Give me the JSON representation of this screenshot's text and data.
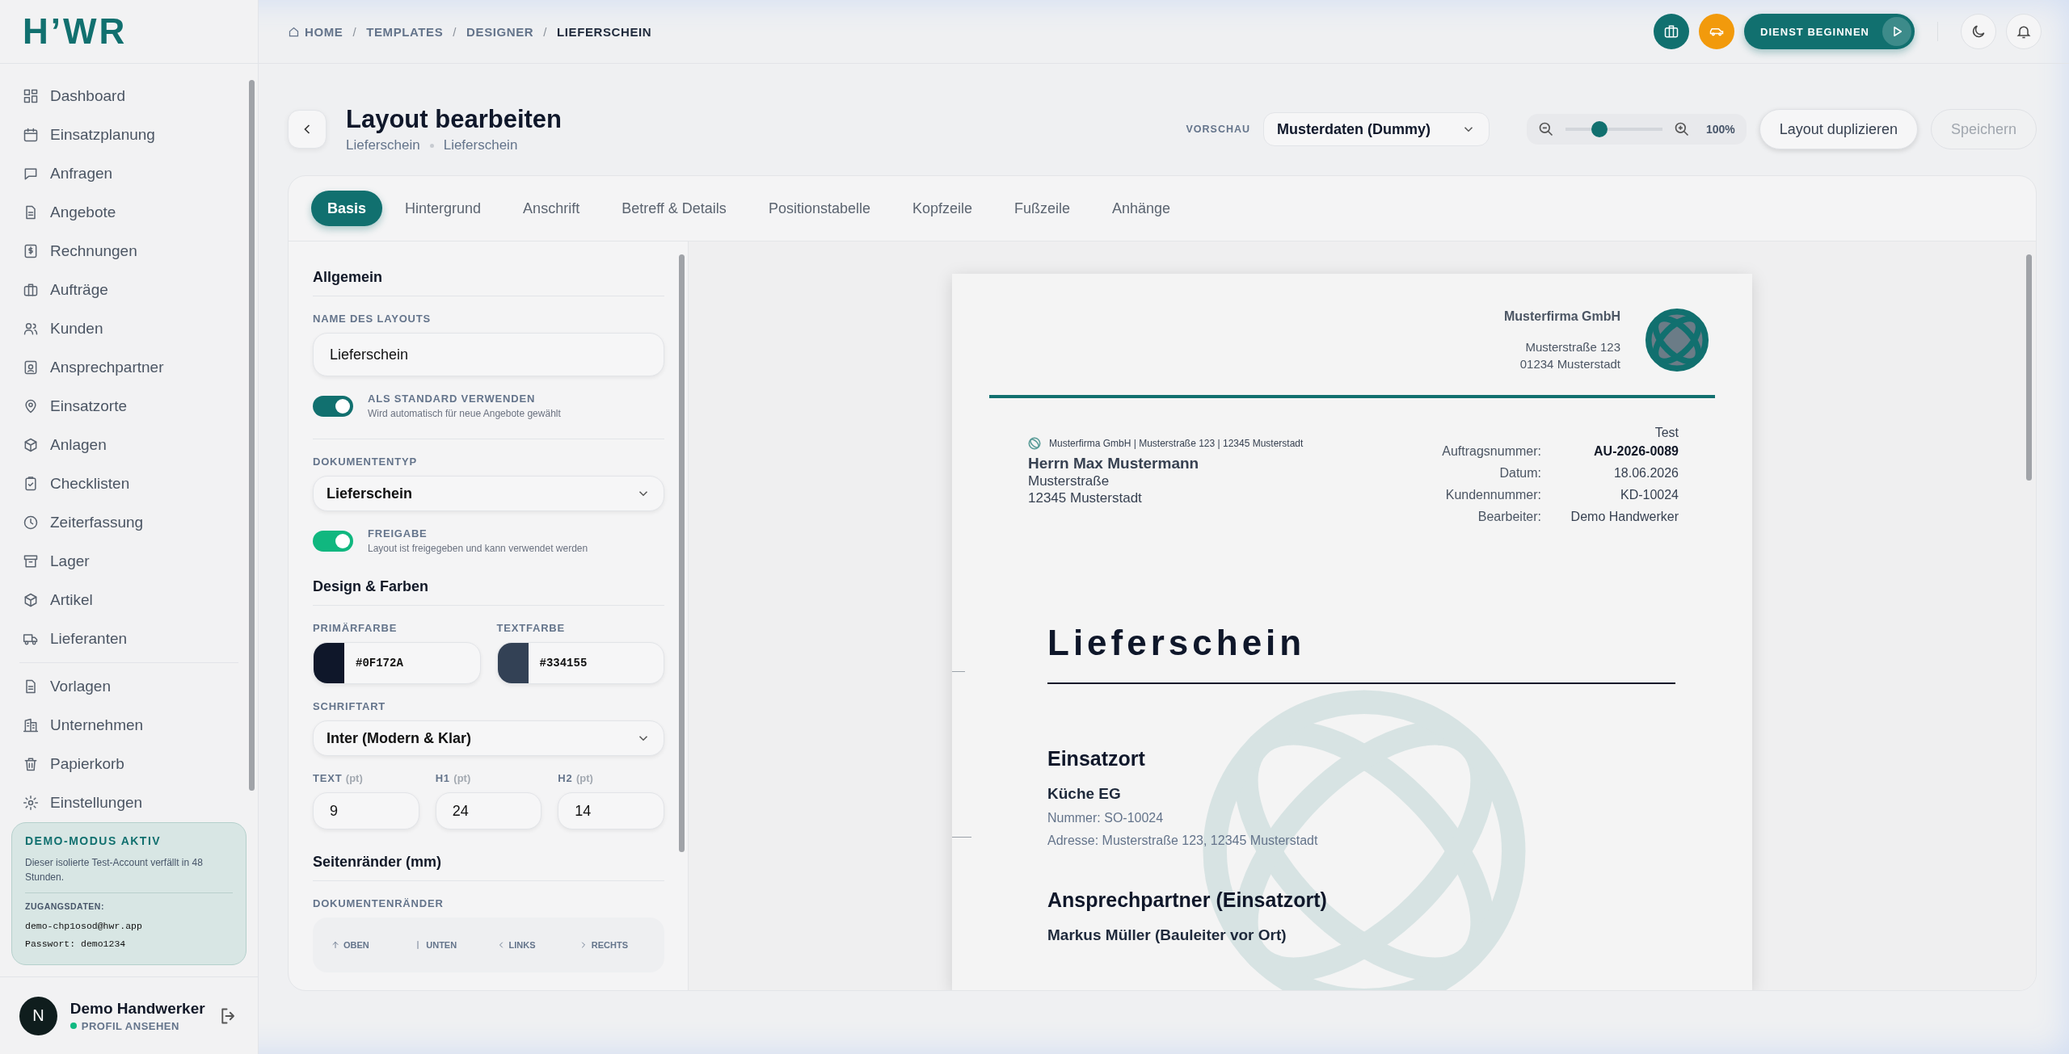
{
  "sidebar": {
    "logo": "H’WR",
    "nav_groups": [
      [
        "Dashboard",
        "Einsatzplanung",
        "Anfragen",
        "Angebote",
        "Rechnungen",
        "Aufträge",
        "Kunden",
        "Ansprechpartner",
        "Einsatzorte",
        "Anlagen",
        "Checklisten",
        "Zeiterfassung",
        "Lager",
        "Artikel",
        "Lieferanten"
      ],
      [
        "Vorlagen",
        "Unternehmen",
        "Papierkorb",
        "Einstellungen"
      ]
    ],
    "demo": {
      "title": "DEMO-MODUS AKTIV",
      "text": "Dieser isolierte Test-Account verfällt in 48 Stunden.",
      "credentials_label": "ZUGANGSDATEN:",
      "lines": [
        "demo-chp1osod@hwr.app",
        "Passwort: demo1234"
      ]
    },
    "profile": {
      "initial": "N",
      "name": "Demo Handwerker",
      "link": "PROFIL ANSEHEN",
      "online": true
    }
  },
  "breadcrumb": {
    "separator": "/",
    "items": [
      "HOME",
      "TEMPLATES",
      "DESIGNER",
      "LIEFERSCHEIN"
    ]
  },
  "top_actions": {
    "shift_button": "DIENST BEGINNEN"
  },
  "header": {
    "title": "Layout bearbeiten",
    "subtitle": [
      "Lieferschein",
      "Lieferschein"
    ]
  },
  "preview": {
    "label": "VORSCHAU",
    "value": "Musterdaten (Dummy)"
  },
  "zoom": {
    "level": 0.35,
    "reading": "100%"
  },
  "buttons": [
    {
      "label": "Layout duplizieren",
      "disabled": false
    },
    {
      "label": "Speichern",
      "disabled": true
    }
  ],
  "tabs": [
    {
      "label": "Basis",
      "selected": true
    },
    {
      "label": "Hintergrund",
      "selected": false
    },
    {
      "label": "Anschrift",
      "selected": false
    },
    {
      "label": "Betreff & Details",
      "selected": false
    },
    {
      "label": "Positionstabelle",
      "selected": false
    },
    {
      "label": "Kopfzeile",
      "selected": false
    },
    {
      "label": "Fußzeile",
      "selected": false
    },
    {
      "label": "Anhänge",
      "selected": false
    }
  ],
  "settings": [
    {
      "kind": "heading",
      "title": "Allgemein"
    },
    {
      "kind": "input",
      "label": "NAME DES LAYOUTS",
      "value": "Lieferschein"
    },
    {
      "kind": "toggle",
      "label": "ALS STANDARD VERWENDEN",
      "hint": "Wird automatisch für neue Angebote gewählt",
      "on": true,
      "color": "#11706f"
    },
    {
      "kind": "divider"
    },
    {
      "kind": "select",
      "label": "DOKUMENTENTYP",
      "value": "Lieferschein"
    },
    {
      "kind": "toggle",
      "label": "FREIGABE",
      "hint": "Layout ist freigegeben und kann verwendet werden",
      "on": true,
      "color": "#10b77f"
    },
    {
      "kind": "heading",
      "title": "Design & Farben"
    },
    {
      "kind": "colors",
      "fields": [
        {
          "label": "PRIMÄRFARBE",
          "value": "#0F172A",
          "color": "#0f172a"
        },
        {
          "label": "TEXTFARBE",
          "value": "#334155",
          "color": "#334155"
        }
      ]
    },
    {
      "kind": "select",
      "label": "SCHRIFTART",
      "value": "Inter (Modern & Klar)"
    },
    {
      "kind": "numbers",
      "fields": [
        {
          "label": "TEXT",
          "unit": "(pt)",
          "value": "9"
        },
        {
          "label": "H1",
          "unit": "(pt)",
          "value": "24"
        },
        {
          "label": "H2",
          "unit": "(pt)",
          "value": "14"
        }
      ]
    },
    {
      "kind": "heading",
      "title": "Seitenränder (mm)"
    },
    {
      "kind": "segments",
      "label": "DOKUMENTENRÄNDER",
      "items": [
        "OBEN",
        "UNTEN",
        "LINKS",
        "RECHTS"
      ]
    }
  ],
  "document": {
    "company": {
      "name": "Musterfirma GmbH",
      "lines": [
        "Musterstraße 123",
        "01234 Musterstadt"
      ]
    },
    "sender_line": "Musterfirma GmbH | Musterstraße 123 | 12345 Musterstadt",
    "recipient": {
      "name": "Herrn Max Mustermann",
      "lines": [
        "Musterstraße",
        "12345 Musterstadt"
      ]
    },
    "meta_title": "Test",
    "meta": [
      {
        "label": "Auftragsnummer:",
        "value": "AU-2026-0089",
        "emphasized": true
      },
      {
        "label": "Datum:",
        "value": "18.06.2026",
        "emphasized": false
      },
      {
        "label": "Kundennummer:",
        "value": "KD-10024",
        "emphasized": false
      },
      {
        "label": "Bearbeiter:",
        "value": "Demo Handwerker",
        "emphasized": false
      }
    ],
    "title": "Lieferschein",
    "sections": [
      {
        "heading": "Einsatzort",
        "name": "Küche EG",
        "lines": [
          "Nummer: SO-10024",
          "Adresse: Musterstraße 123, 12345 Musterstadt"
        ]
      },
      {
        "heading": "Ansprechpartner (Einsatzort)",
        "name": "Markus Müller (Bauleiter vor Ort)"
      }
    ]
  }
}
